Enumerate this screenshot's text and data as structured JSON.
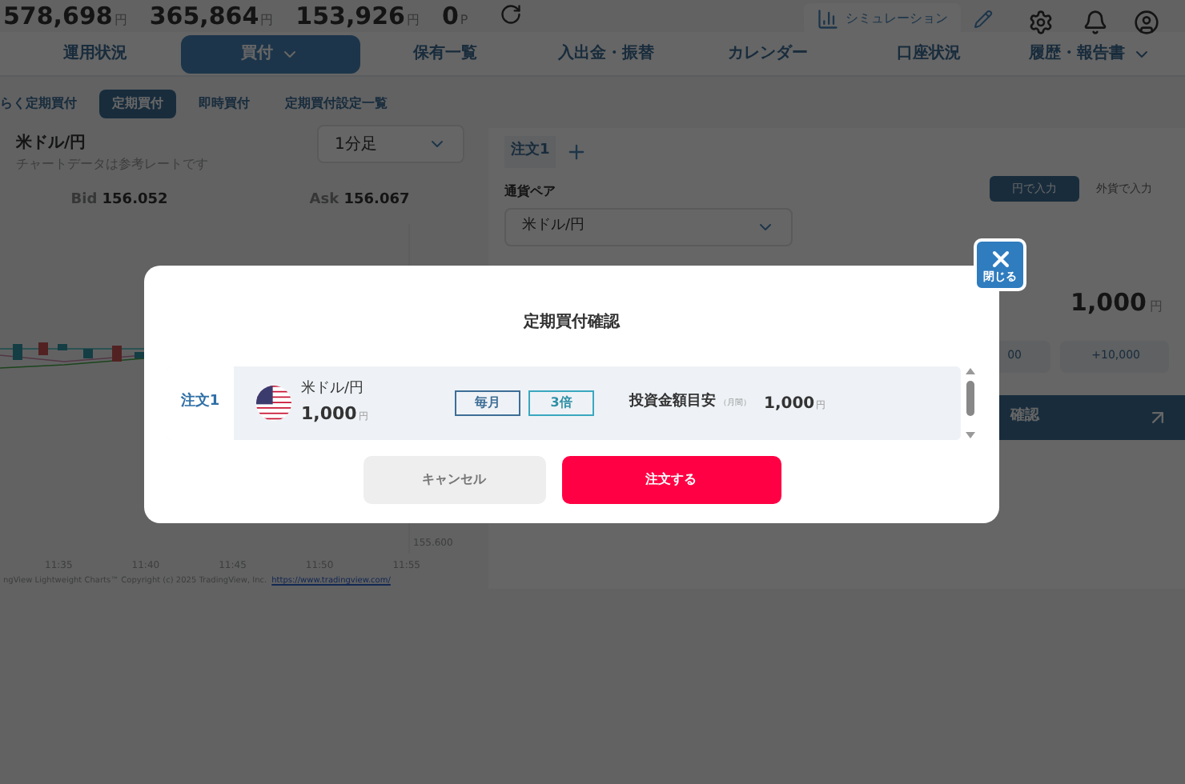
{
  "header": {
    "balances": [
      {
        "value": "578,698",
        "unit": "円"
      },
      {
        "value": "365,864",
        "unit": "円"
      },
      {
        "value": "153,926",
        "unit": "円"
      },
      {
        "value": "0",
        "unit": "P"
      }
    ],
    "simulation_label": "シミュレーション"
  },
  "nav": {
    "tabs": [
      {
        "label": "運用状況",
        "selected": false,
        "dropdown": false
      },
      {
        "label": "買付",
        "selected": true,
        "dropdown": true
      },
      {
        "label": "保有一覧",
        "selected": false,
        "dropdown": false
      },
      {
        "label": "入出金・振替",
        "selected": false,
        "dropdown": false
      },
      {
        "label": "カレンダー",
        "selected": false,
        "dropdown": false
      },
      {
        "label": "口座状況",
        "selected": false,
        "dropdown": false
      },
      {
        "label": "履歴・報告書",
        "selected": false,
        "dropdown": true
      }
    ]
  },
  "subtabs": [
    {
      "label": "らく定期買付",
      "selected": false
    },
    {
      "label": "定期買付",
      "selected": true
    },
    {
      "label": "即時買付",
      "selected": false
    },
    {
      "label": "定期買付設定一覧",
      "selected": false
    }
  ],
  "chart_panel": {
    "pair": "米ドル/円",
    "note": "チャートデータは参考レートです",
    "timeframe": "1分足",
    "bid": {
      "label": "Bid",
      "value": "156.052"
    },
    "ask": {
      "label": "Ask",
      "value": "156.067"
    },
    "price_labels": [
      "155.600"
    ],
    "time_labels": [
      "11:35",
      "11:40",
      "11:45",
      "11:50",
      "11:55"
    ],
    "attribution": "ngView Lightweight Charts™ Copyright (c) 2025 TradingView, Inc.",
    "attribution_link": "https://www.tradingview.com/"
  },
  "order_panel": {
    "tabs": [
      {
        "label": "注文1",
        "selected": true
      }
    ],
    "pair_label": "通貨ペア",
    "pair_value": "米ドル/円",
    "input_modes": [
      {
        "label": "円で入力",
        "selected": true
      },
      {
        "label": "外貨で入力",
        "selected": false
      }
    ],
    "amount": "1,000",
    "amount_unit": "円",
    "quick_buttons": [
      "00",
      "+10,000"
    ],
    "confirm_button": "確認"
  },
  "modal": {
    "title": "定期買付確認",
    "close_label": "閉じる",
    "orders": [
      {
        "tab": "注文1",
        "pair": "米ドル/円",
        "amount": "1,000",
        "unit": "円",
        "frequency": "毎月",
        "multiplier": "3倍",
        "estimate_label": "投資金額目安",
        "estimate_period": "（月間）",
        "estimate_value": "1,000",
        "estimate_unit": "円"
      }
    ],
    "cancel_button": "キャンセル",
    "submit_button": "注文する"
  }
}
